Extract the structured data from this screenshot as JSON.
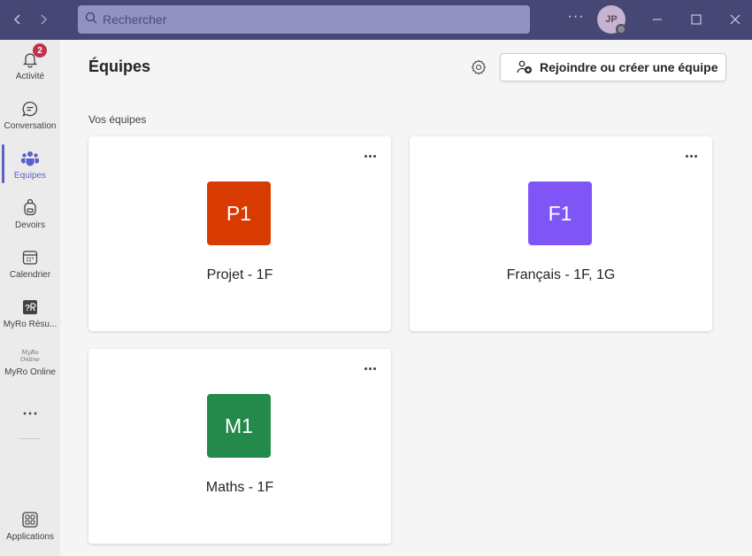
{
  "search": {
    "placeholder": "Rechercher"
  },
  "user": {
    "initials": "JP"
  },
  "rail": {
    "items": [
      {
        "label": "Activité",
        "badge": "2"
      },
      {
        "label": "Conversation"
      },
      {
        "label": "Équipes"
      },
      {
        "label": "Devoirs"
      },
      {
        "label": "Calendrier"
      },
      {
        "label": "MyRo Résu..."
      },
      {
        "label": "MyRo Online",
        "logo_text": "MyRo Online"
      },
      {
        "label": "Applications"
      }
    ]
  },
  "main": {
    "title": "Équipes",
    "join_button": "Rejoindre ou créer une équipe",
    "section_label": "Vos équipes",
    "teams": [
      {
        "initials": "P1",
        "name": "Projet - 1F",
        "color": "#d83b01"
      },
      {
        "initials": "F1",
        "name": "Français - 1F, 1G",
        "color": "#7f56f5"
      },
      {
        "initials": "M1",
        "name": "Maths - 1F",
        "color": "#248a4c"
      }
    ]
  },
  "colors": {
    "titlebar": "#464775",
    "accent": "#5b5fc7",
    "badge": "#c4314b"
  }
}
